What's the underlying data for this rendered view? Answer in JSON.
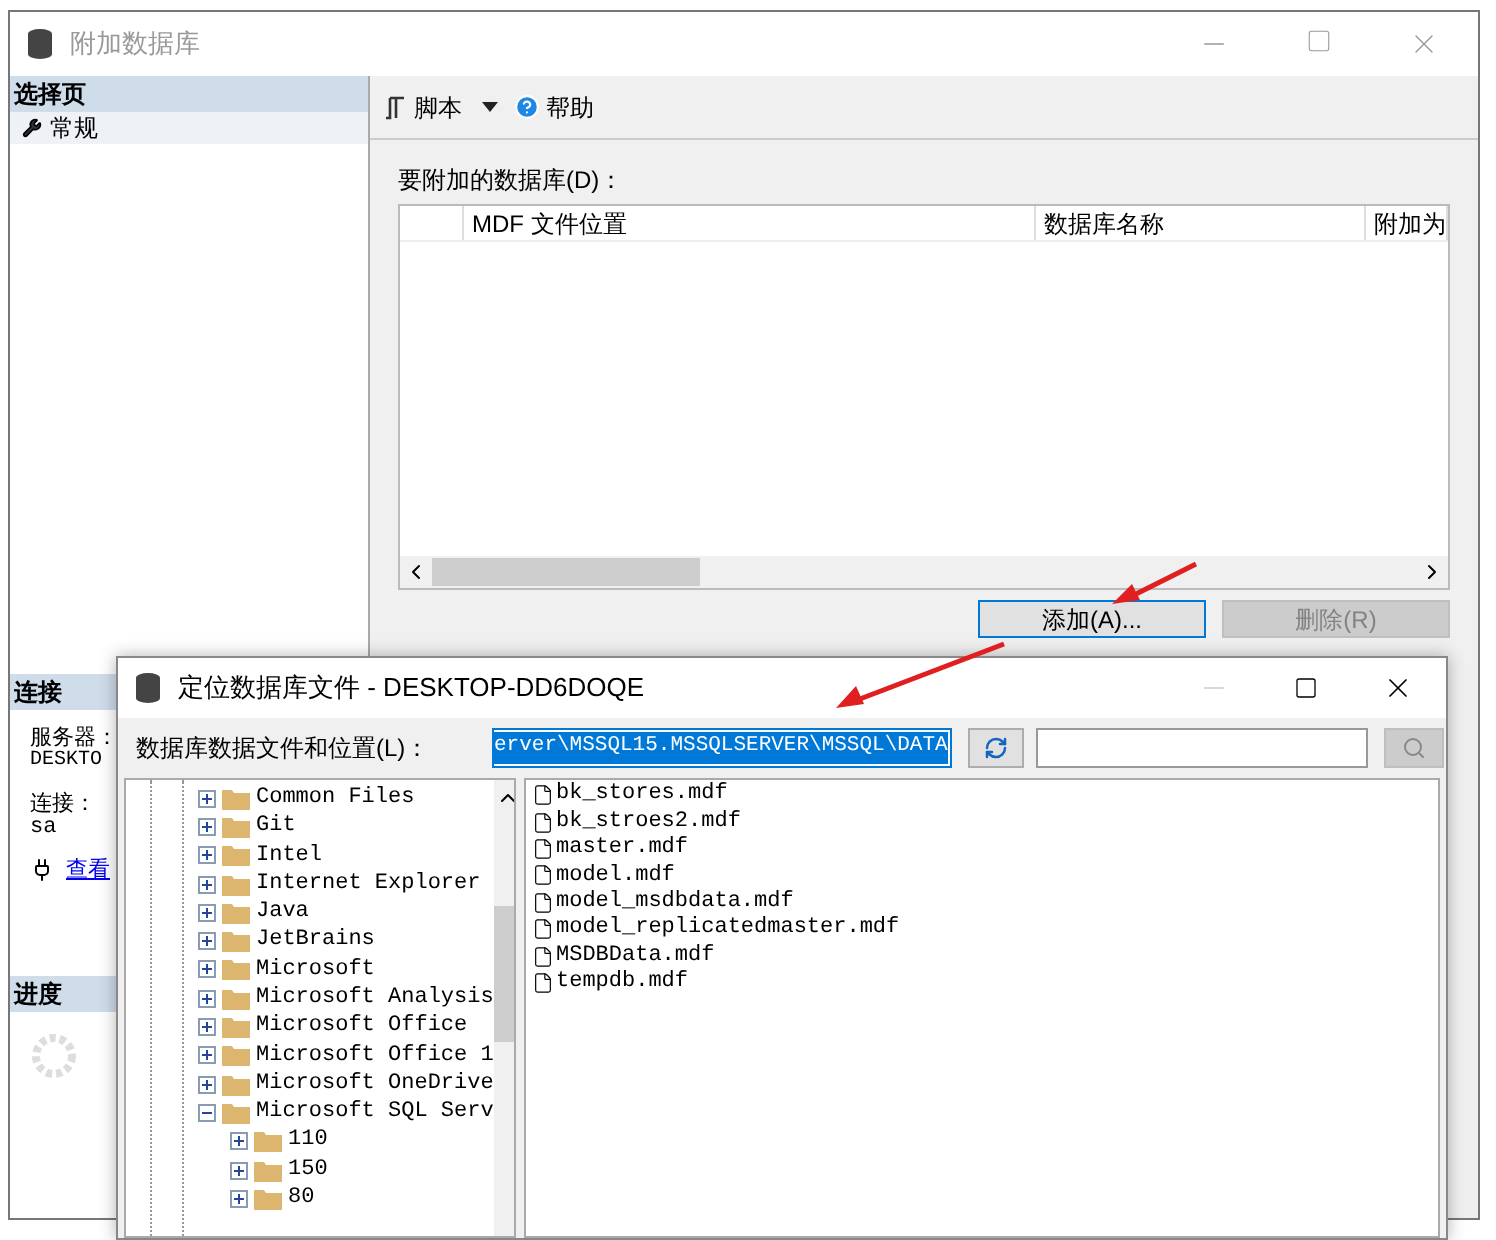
{
  "window": {
    "title": "附加数据库"
  },
  "sidebar": {
    "header": "选择页",
    "items": [
      {
        "label": "常规",
        "selected": true
      }
    ]
  },
  "toolbar": {
    "script": "脚本",
    "help": "帮助"
  },
  "attach": {
    "label": "要附加的数据库(D)：",
    "columns": [
      "MDF 文件位置",
      "数据库名称",
      "附加为"
    ],
    "add_button": "添加(A)...",
    "remove_button": {
      "label": "删除(R)",
      "disabled": true
    }
  },
  "connection": {
    "header": "连接",
    "server_label": "服务器：",
    "server": "DESKTO",
    "conn_label": "连接：",
    "user": "sa",
    "link": "查看"
  },
  "progress": {
    "header": "进度"
  },
  "dialog": {
    "title": "定位数据库文件 - DESKTOP-DD6DOQE",
    "path_label": "数据库数据文件和位置(L)：",
    "path": "erver\\MSSQL15.MSSQLSERVER\\MSSQL\\DATA",
    "tree": [
      {
        "label": "Common Files",
        "expanded": false
      },
      {
        "label": "Git",
        "expanded": false
      },
      {
        "label": "Intel",
        "expanded": false
      },
      {
        "label": "Internet Explorer",
        "expanded": false
      },
      {
        "label": "Java",
        "expanded": false
      },
      {
        "label": "JetBrains",
        "expanded": false
      },
      {
        "label": "Microsoft",
        "expanded": false
      },
      {
        "label": "Microsoft Analysis",
        "expanded": false
      },
      {
        "label": "Microsoft Office",
        "expanded": false
      },
      {
        "label": "Microsoft Office 1",
        "expanded": false
      },
      {
        "label": "Microsoft OneDrive",
        "expanded": false
      },
      {
        "label": "Microsoft SQL Serv",
        "expanded": true,
        "children": [
          {
            "label": "110",
            "expanded": false
          },
          {
            "label": "150",
            "expanded": false
          },
          {
            "label": "80",
            "expanded": false
          }
        ]
      }
    ],
    "files": [
      "bk_stores.mdf",
      "bk_stroes2.mdf",
      "master.mdf",
      "model.mdf",
      "model_msdbdata.mdf",
      "model_replicatedmaster.mdf",
      "MSDBData.mdf",
      "tempdb.mdf"
    ]
  }
}
